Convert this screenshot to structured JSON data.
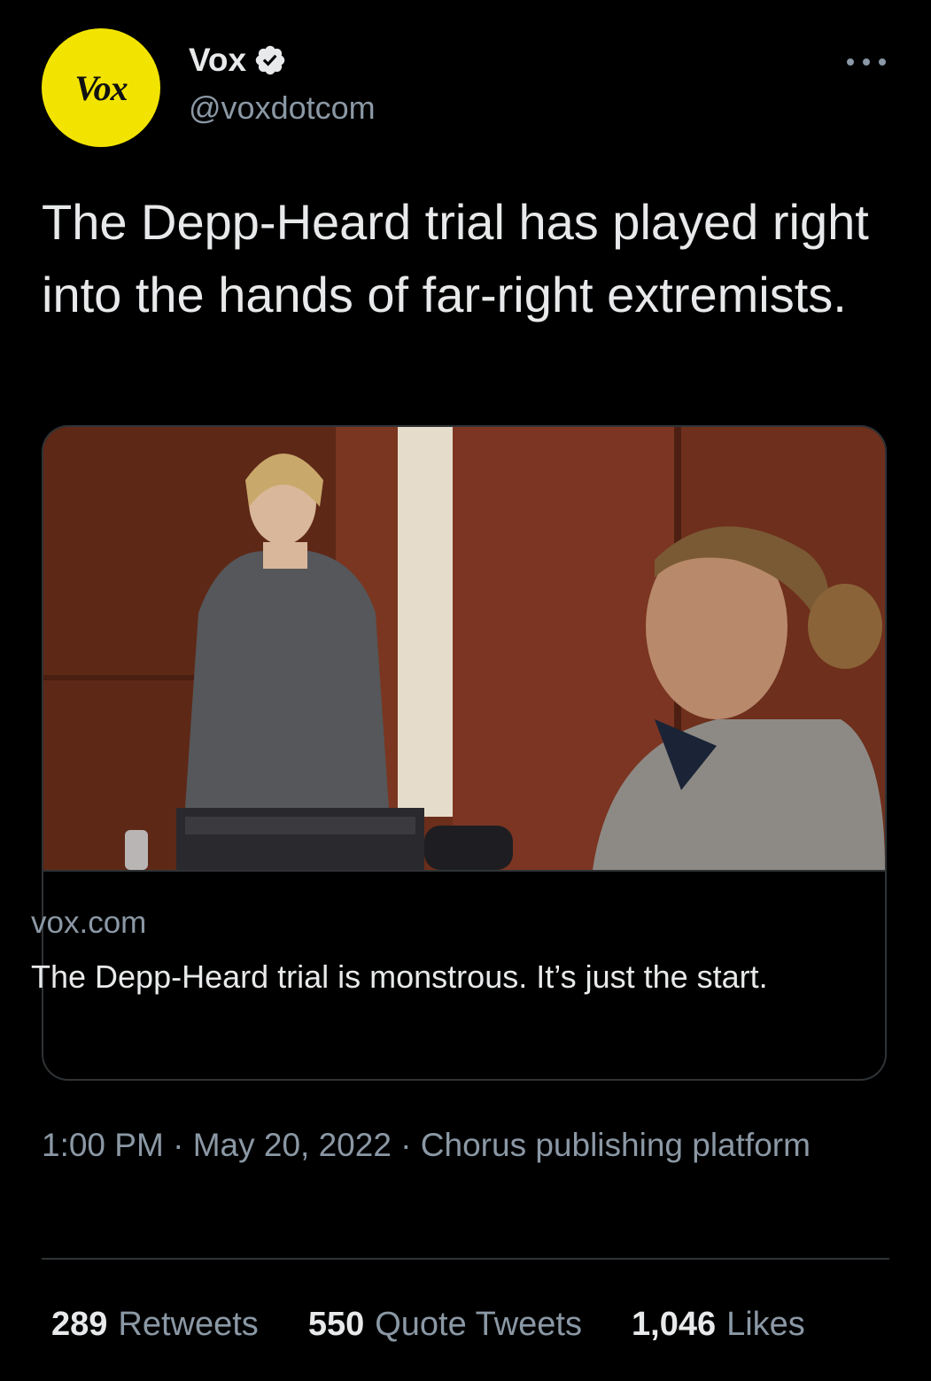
{
  "author": {
    "name": "Vox",
    "handle": "@voxdotcom",
    "avatar_text": "Vox",
    "avatar_color": "#f2e400",
    "verified": true
  },
  "tweet": {
    "text": "The Depp-Heard trial has played right into the hands of far-right extremists."
  },
  "card": {
    "domain": "vox.com",
    "title": "The Depp-Heard trial is monstrous. It’s just the start.",
    "image_description_icon": "photo-icon"
  },
  "meta": {
    "time": "1:00 PM",
    "separator": " · ",
    "date": "May 20, 2022",
    "source": "Chorus publishing platform"
  },
  "stats": {
    "retweets_count": "289",
    "retweets_label": "Retweets",
    "quotes_count": "550",
    "quotes_label": "Quote Tweets",
    "likes_count": "1,046",
    "likes_label": "Likes"
  },
  "colors": {
    "background": "#000000",
    "text_primary": "#e7e9ea",
    "text_secondary": "#8b98a5",
    "border": "#2f3336"
  }
}
